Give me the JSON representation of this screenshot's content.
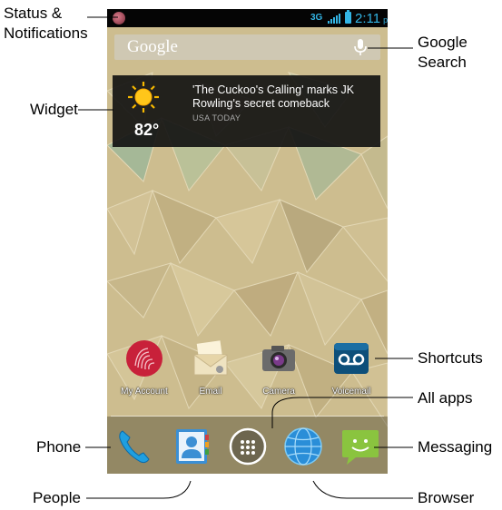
{
  "callouts": {
    "status_line1": "Status &",
    "status_line2": "Notifications",
    "widget": "Widget",
    "google_line1": "Google",
    "google_line2": "Search",
    "shortcuts": "Shortcuts",
    "all_apps": "All apps",
    "phone": "Phone",
    "messaging": "Messaging",
    "people": "People",
    "browser": "Browser"
  },
  "status_bar": {
    "network": "3G",
    "time": "2:11",
    "ampm": "pm"
  },
  "search": {
    "logo": "Google",
    "mic_icon": "microphone-icon"
  },
  "weather_widget": {
    "temperature": "82°",
    "headline": "'The Cuckoo's Calling' marks JK Rowling's secret comeback",
    "source": "USA TODAY",
    "icon": "sun-icon"
  },
  "shortcuts": [
    {
      "label": "My Account",
      "icon": "my-account-icon"
    },
    {
      "label": "Email",
      "icon": "email-icon"
    },
    {
      "label": "Camera",
      "icon": "camera-icon"
    },
    {
      "label": "Voicemail",
      "icon": "voicemail-icon"
    }
  ],
  "dock": [
    {
      "name": "Phone",
      "icon": "phone-icon"
    },
    {
      "name": "People",
      "icon": "people-icon"
    },
    {
      "name": "All apps",
      "icon": "all-apps-icon"
    },
    {
      "name": "Browser",
      "icon": "browser-icon"
    },
    {
      "name": "Messaging",
      "icon": "messaging-icon"
    }
  ],
  "colors": {
    "status_accent": "#33b5e5",
    "widget_bg": "#0f0f0f",
    "messaging_green": "#8ac43f"
  }
}
